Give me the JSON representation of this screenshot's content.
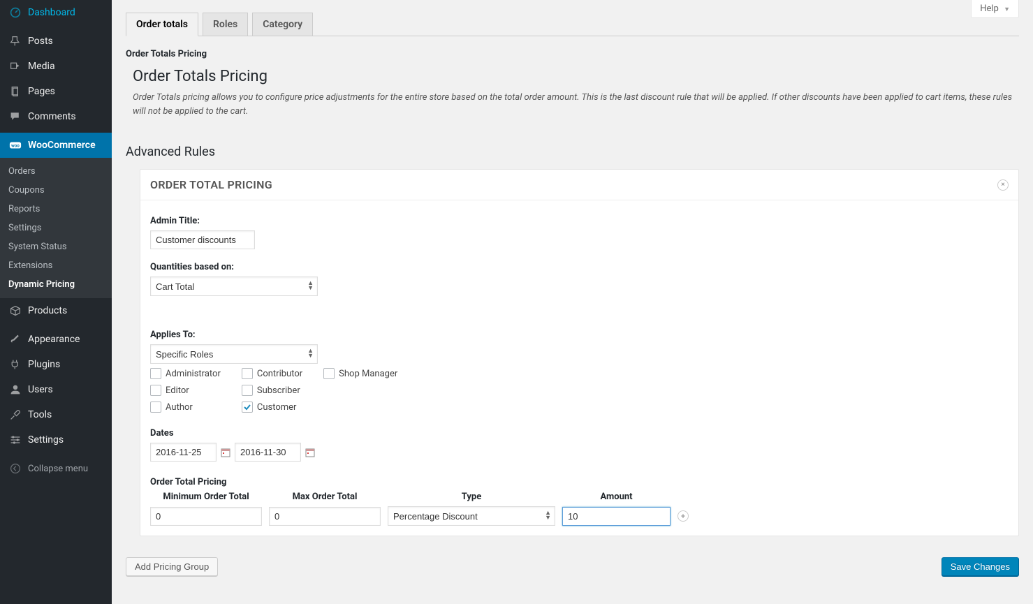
{
  "help_label": "Help",
  "sidebar": {
    "dashboard": "Dashboard",
    "posts": "Posts",
    "media": "Media",
    "pages": "Pages",
    "comments": "Comments",
    "woocommerce": "WooCommerce",
    "sub": {
      "orders": "Orders",
      "coupons": "Coupons",
      "reports": "Reports",
      "settings": "Settings",
      "system_status": "System Status",
      "extensions": "Extensions",
      "dynamic_pricing": "Dynamic Pricing"
    },
    "products": "Products",
    "appearance": "Appearance",
    "plugins": "Plugins",
    "users": "Users",
    "tools": "Tools",
    "settings2": "Settings",
    "collapse": "Collapse menu"
  },
  "tabs": {
    "order_totals": "Order totals",
    "roles": "Roles",
    "category": "Category"
  },
  "section_label": "Order Totals Pricing",
  "page_title": "Order Totals Pricing",
  "description": "Order Totals pricing allows you to configure price adjustments for the entire store based on the total order amount. This is the last discount rule that will be applied. If other discounts have been applied to cart items, these rules will not be applied to the cart.",
  "advanced_heading": "Advanced Rules",
  "panel_title": "ORDER TOTAL PRICING",
  "fields": {
    "admin_title_label": "Admin Title:",
    "admin_title_value": "Customer discounts",
    "quantities_label": "Quantities based on:",
    "quantities_value": "Cart Total",
    "applies_label": "Applies To:",
    "applies_value": "Specific Roles",
    "roles": {
      "administrator": "Administrator",
      "editor": "Editor",
      "author": "Author",
      "contributor": "Contributor",
      "subscriber": "Subscriber",
      "customer": "Customer",
      "shop_manager": "Shop Manager"
    },
    "customer_checked": true,
    "dates_label": "Dates",
    "date_from": "2016-11-25",
    "date_to": "2016-11-30",
    "pricing_label": "Order Total Pricing",
    "cols": {
      "min": "Minimum Order Total",
      "max": "Max Order Total",
      "type": "Type",
      "amount": "Amount"
    },
    "row": {
      "min": "0",
      "max": "0",
      "type": "Percentage Discount",
      "amount": "10"
    }
  },
  "buttons": {
    "add_group": "Add Pricing Group",
    "save": "Save Changes"
  }
}
